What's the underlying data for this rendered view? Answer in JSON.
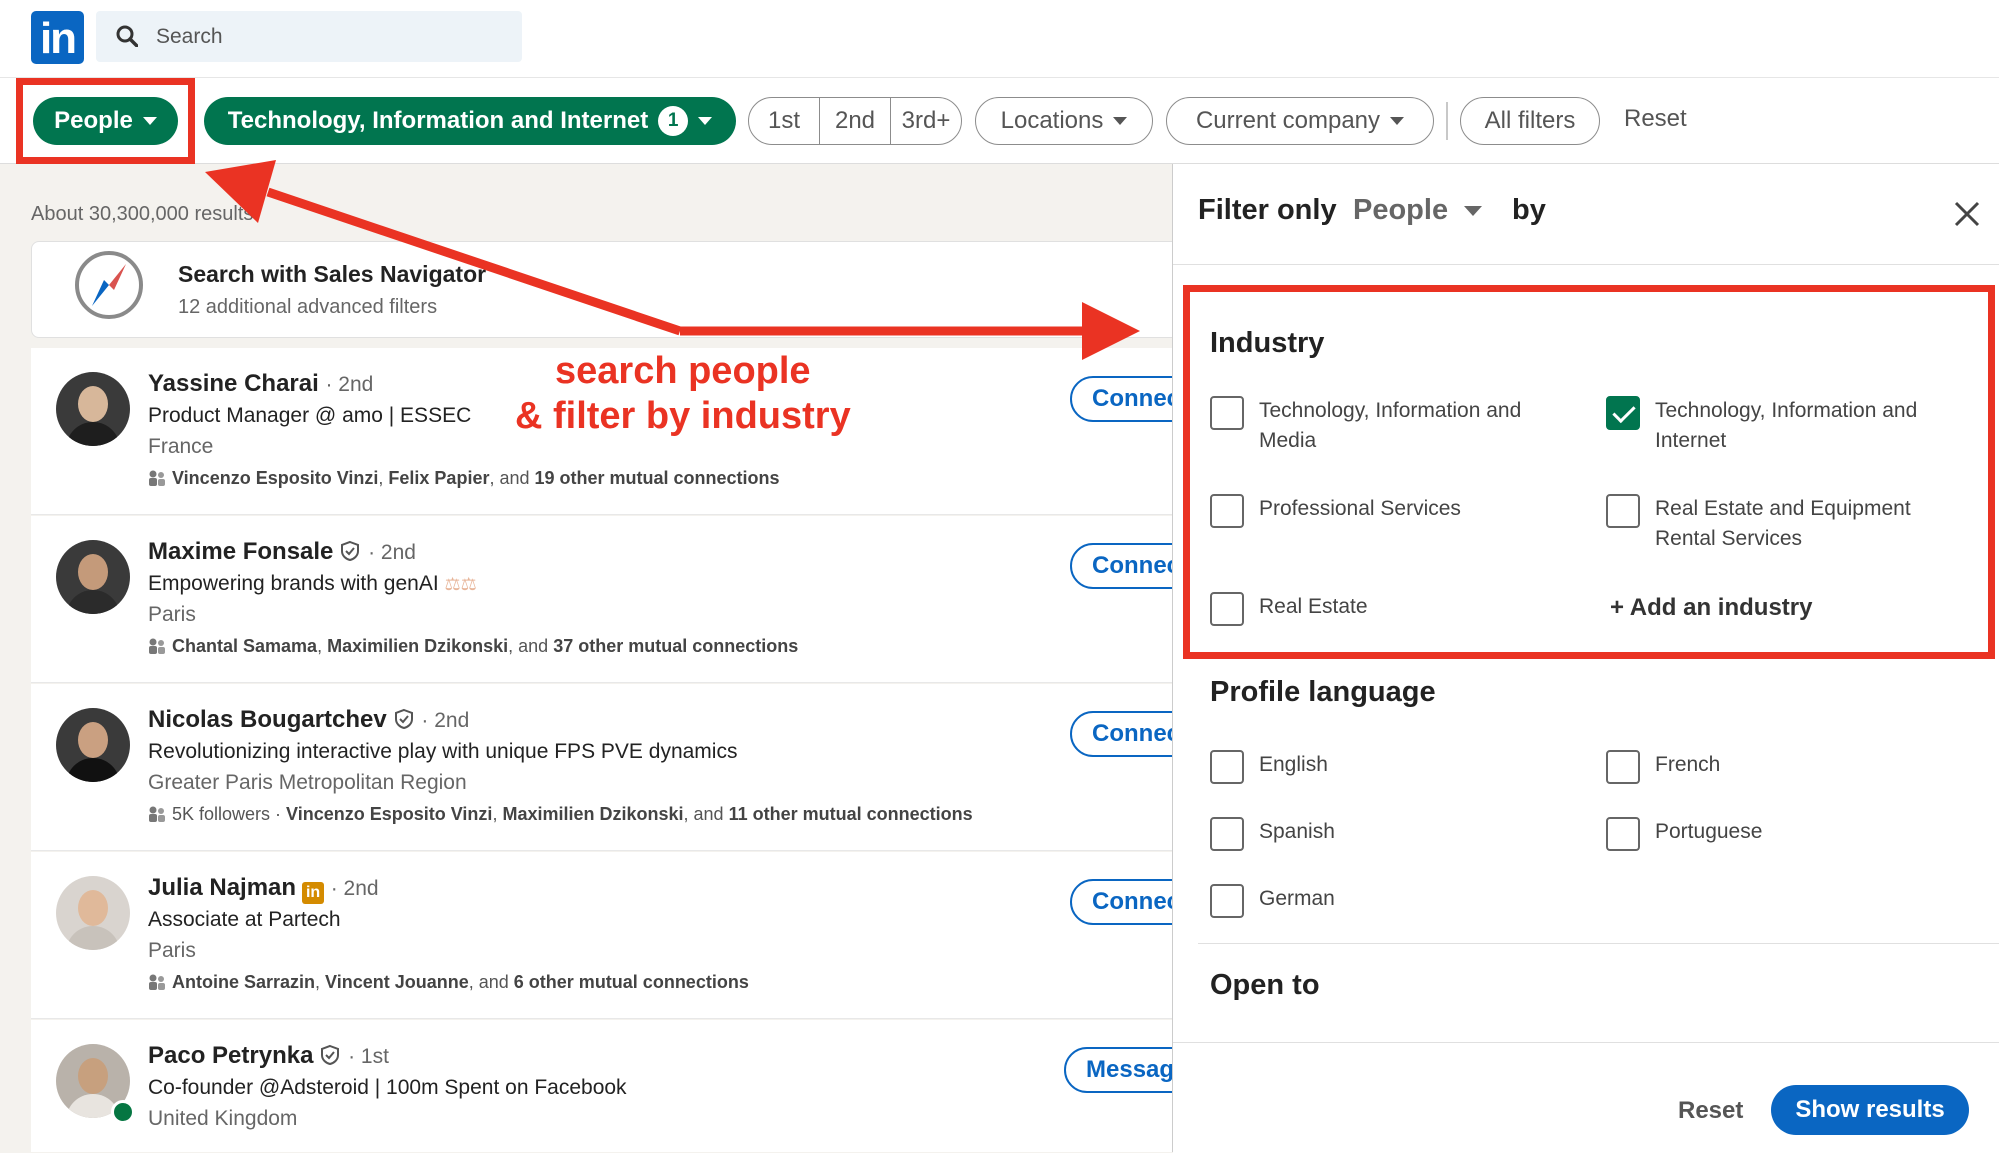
{
  "header": {
    "logo_text": "in",
    "search_placeholder": "Search"
  },
  "filters": {
    "people_label": "People",
    "industry_label": "Technology, Information and Internet",
    "industry_count": "1",
    "degrees": [
      "1st",
      "2nd",
      "3rd+"
    ],
    "locations_label": "Locations",
    "company_label": "Current company",
    "all_filters_label": "All filters",
    "reset_label": "Reset"
  },
  "results": {
    "count_text": "About 30,300,000 results",
    "sales_nav_title": "Search with Sales Navigator",
    "sales_nav_sub": "12 additional advanced filters"
  },
  "people": [
    {
      "name": "Yassine Charai",
      "degree": "· 2nd",
      "headline": "Product Manager @ amo | ESSEC",
      "location": "France",
      "m1": "Vincenzo Esposito Vinzi",
      "m2": "Felix Papier",
      "mjoin": ", ",
      "mmid": ", and ",
      "mrest": "19 other mutual connections",
      "action": "Connect"
    },
    {
      "name": "Maxime Fonsale",
      "degree": "· 2nd",
      "headline": "Empowering brands with genAI",
      "location": "Paris",
      "m1": "Chantal Samama",
      "m2": "Maximilien Dzikonski",
      "mjoin": ", ",
      "mmid": ", and ",
      "mrest": "37 other mutual connections",
      "action": "Connect"
    },
    {
      "name": "Nicolas Bougartchev",
      "degree": "· 2nd",
      "headline": "Revolutionizing interactive play with unique FPS PVE dynamics",
      "location": "Greater Paris Metropolitan Region",
      "followers": "5K followers · ",
      "m1": "Vincenzo Esposito Vinzi",
      "m2": "Maximilien Dzikonski",
      "mjoin": ", ",
      "mmid": ", and ",
      "mrest": "11 other mutual connections",
      "action": "Connect"
    },
    {
      "name": "Julia Najman",
      "degree": "· 2nd",
      "headline": "Associate at Partech",
      "location": "Paris",
      "m1": "Antoine Sarrazin",
      "m2": "Vincent Jouanne",
      "mjoin": ", ",
      "mmid": ", and ",
      "mrest": "6 other mutual connections",
      "action": "Connect"
    },
    {
      "name": "Paco Petrynka",
      "degree": "· 1st",
      "headline": "Co-founder @Adsteroid | 100m Spent on Facebook",
      "location": "United Kingdom",
      "action": "Message"
    }
  ],
  "panel": {
    "title_prefix": "Filter only",
    "title_select": "People",
    "title_suffix": "by",
    "industry": {
      "title": "Industry",
      "options": [
        {
          "label": "Technology, Information and Media",
          "checked": false
        },
        {
          "label": "Technology, Information and Internet",
          "checked": true
        },
        {
          "label": "Professional Services",
          "checked": false
        },
        {
          "label": "Real Estate and Equipment Rental Services",
          "checked": false
        },
        {
          "label": "Real Estate",
          "checked": false
        }
      ],
      "add_label": "+ Add an industry"
    },
    "language": {
      "title": "Profile language",
      "options": [
        "English",
        "French",
        "Spanish",
        "Portuguese",
        "German"
      ]
    },
    "open_to_title": "Open to",
    "reset_label": "Reset",
    "show_results_label": "Show results"
  },
  "annotation": {
    "line1": "search people",
    "line2": "& filter by industry",
    "color": "#ea3323"
  },
  "colors": {
    "linkedin_blue": "#0a66c2",
    "green": "#01754f"
  }
}
